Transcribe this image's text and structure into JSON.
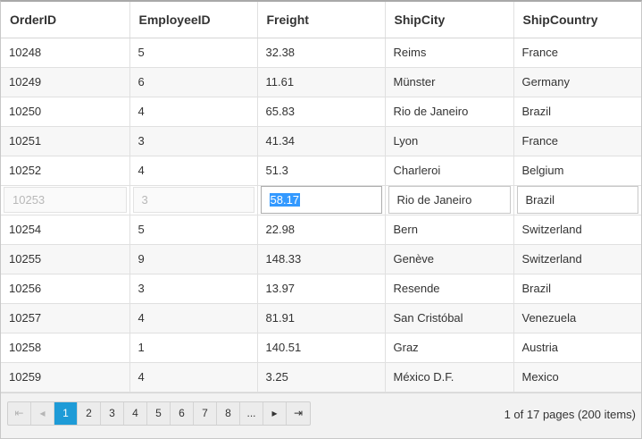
{
  "columns": [
    "OrderID",
    "EmployeeID",
    "Freight",
    "ShipCity",
    "ShipCountry"
  ],
  "rows": [
    [
      "10248",
      "5",
      "32.38",
      "Reims",
      "France"
    ],
    [
      "10249",
      "6",
      "11.61",
      "Münster",
      "Germany"
    ],
    [
      "10250",
      "4",
      "65.83",
      "Rio de Janeiro",
      "Brazil"
    ],
    [
      "10251",
      "3",
      "41.34",
      "Lyon",
      "France"
    ],
    [
      "10252",
      "4",
      "51.3",
      "Charleroi",
      "Belgium"
    ],
    [
      "10253",
      "3",
      "58.17",
      "Rio de Janeiro",
      "Brazil"
    ],
    [
      "10254",
      "5",
      "22.98",
      "Bern",
      "Switzerland"
    ],
    [
      "10255",
      "9",
      "148.33",
      "Genève",
      "Switzerland"
    ],
    [
      "10256",
      "3",
      "13.97",
      "Resende",
      "Brazil"
    ],
    [
      "10257",
      "4",
      "81.91",
      "San Cristóbal",
      "Venezuela"
    ],
    [
      "10258",
      "1",
      "140.51",
      "Graz",
      "Austria"
    ],
    [
      "10259",
      "4",
      "3.25",
      "México D.F.",
      "Mexico"
    ]
  ],
  "edit_row_index": 5,
  "pager": {
    "first_icon": "first-page-icon",
    "prev_icon": "previous-page-icon",
    "next_icon": "next-page-icon",
    "last_icon": "last-page-icon",
    "pages": [
      "1",
      "2",
      "3",
      "4",
      "5",
      "6",
      "7",
      "8",
      "..."
    ],
    "current_page": "1",
    "first_glyph": "⇤",
    "prev_glyph": "◂",
    "next_glyph": "▸",
    "last_glyph": "⇥",
    "info": "1 of 17 pages (200 items)",
    "accent_color": "#1e9bd7"
  }
}
